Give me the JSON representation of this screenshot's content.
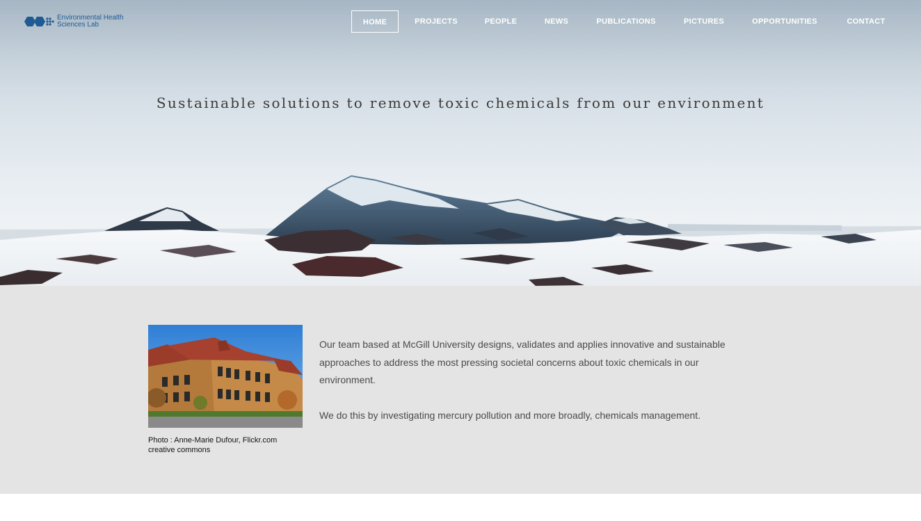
{
  "logo": {
    "line1": "Environmental Health",
    "line2": "Sciences Lab",
    "brand_color": "#1f5a93"
  },
  "nav": {
    "items": [
      {
        "label": "HOME",
        "active": true
      },
      {
        "label": "PROJECTS",
        "active": false
      },
      {
        "label": "PEOPLE",
        "active": false
      },
      {
        "label": "NEWS",
        "active": false
      },
      {
        "label": "PUBLICATIONS",
        "active": false
      },
      {
        "label": "PICTURES",
        "active": false
      },
      {
        "label": "OPPORTUNITIES",
        "active": false
      },
      {
        "label": "CONTACT",
        "active": false
      }
    ]
  },
  "hero": {
    "tagline": "Sustainable solutions to remove toxic chemicals from our environment"
  },
  "about": {
    "photo_caption_line1": "Photo : Anne-Marie Dufour, Flickr.com",
    "photo_caption_line2": "creative commons",
    "paragraph1": "Our team based at McGill University designs, validates and applies innovative and sustainable approaches to address the most pressing societal concerns about toxic chemicals in our environment.",
    "paragraph2": "We do this by investigating mercury pollution and more broadly, chemicals management."
  },
  "colors": {
    "section_background": "#e4e4e4",
    "nav_text": "#ffffff",
    "body_text": "#4a4a4a"
  }
}
